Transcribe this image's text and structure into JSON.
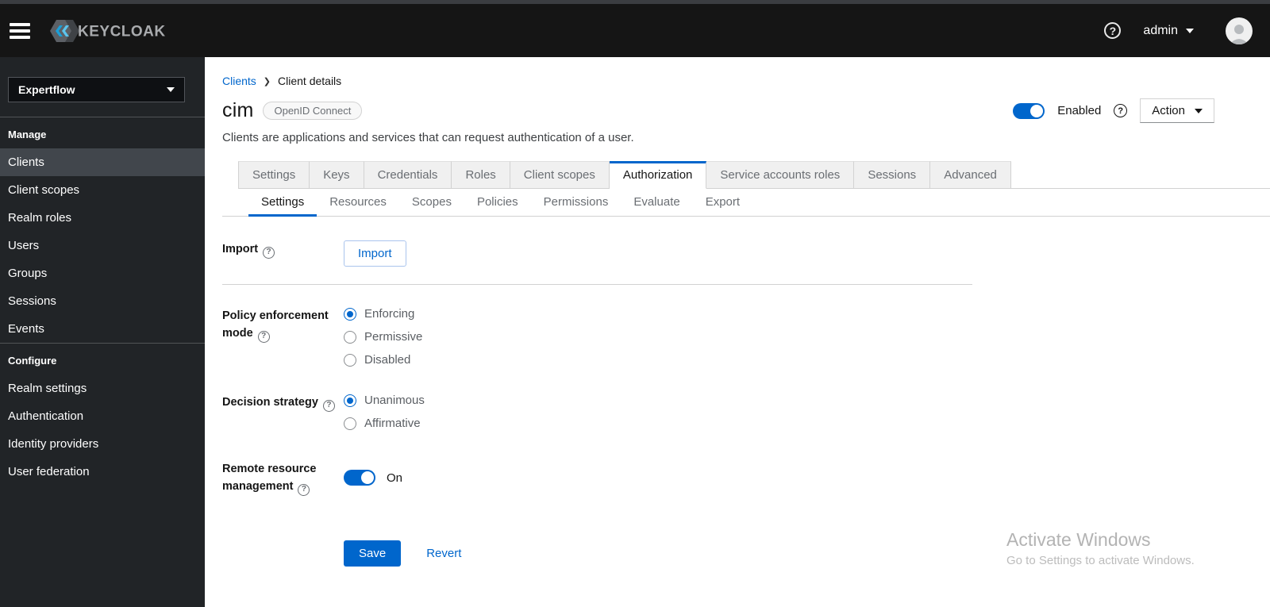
{
  "colors": {
    "accent": "#0066cc",
    "header_bg": "#151515",
    "sidebar_bg": "#212427",
    "tab_inactive_bg": "#f0f0f0"
  },
  "header": {
    "brand": "KEYCLOAK",
    "help_icon": "?",
    "user": "admin"
  },
  "sidebar": {
    "realm_selector": "Expertflow",
    "sections": [
      {
        "label": "Manage",
        "items": [
          {
            "label": "Clients",
            "active": true
          },
          {
            "label": "Client scopes"
          },
          {
            "label": "Realm roles"
          },
          {
            "label": "Users"
          },
          {
            "label": "Groups"
          },
          {
            "label": "Sessions"
          },
          {
            "label": "Events"
          }
        ]
      },
      {
        "label": "Configure",
        "items": [
          {
            "label": "Realm settings"
          },
          {
            "label": "Authentication"
          },
          {
            "label": "Identity providers"
          },
          {
            "label": "User federation"
          }
        ]
      }
    ]
  },
  "breadcrumb": {
    "parent": "Clients",
    "current": "Client details"
  },
  "client": {
    "title": "cim",
    "protocol_badge": "OpenID Connect",
    "description": "Clients are applications and services that can request authentication of a user.",
    "enabled_label": "Enabled",
    "action_button": "Action"
  },
  "tabs": {
    "active": "Authorization",
    "items": [
      "Settings",
      "Keys",
      "Credentials",
      "Roles",
      "Client scopes",
      "Authorization",
      "Service accounts roles",
      "Sessions",
      "Advanced"
    ]
  },
  "subtabs": {
    "active": "Settings",
    "items": [
      "Settings",
      "Resources",
      "Scopes",
      "Policies",
      "Permissions",
      "Evaluate",
      "Export"
    ]
  },
  "form": {
    "import": {
      "label": "Import",
      "button_label": "Import"
    },
    "policy_enforcement_mode": {
      "label": "Policy enforcement mode",
      "options": [
        "Enforcing",
        "Permissive",
        "Disabled"
      ],
      "selected": "Enforcing"
    },
    "decision_strategy": {
      "label": "Decision strategy",
      "options": [
        "Unanimous",
        "Affirmative"
      ],
      "selected": "Unanimous"
    },
    "remote_resource_management": {
      "label": "Remote resource management",
      "enabled": true,
      "state_label": "On"
    },
    "save_button": "Save",
    "revert_button": "Revert"
  },
  "watermark": {
    "line1": "Activate Windows",
    "line2": "Go to Settings to activate Windows."
  }
}
